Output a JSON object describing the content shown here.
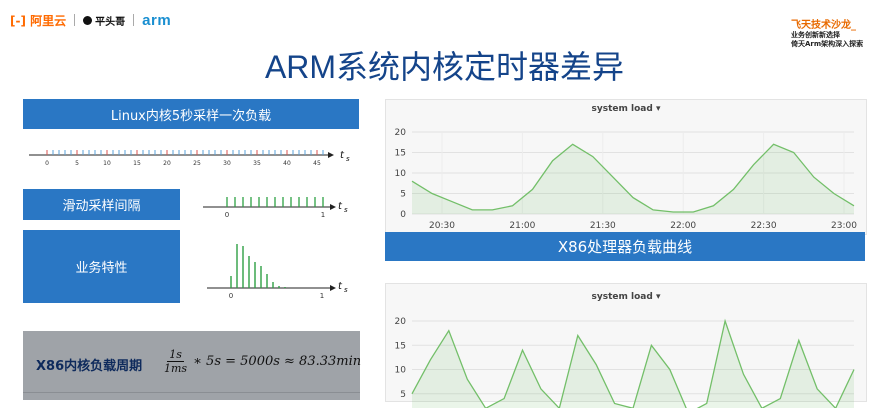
{
  "header": {
    "logo_aliyun": "阿里云",
    "logo_pingtouge": "平头哥",
    "logo_arm": "arm",
    "corner_title": "飞天技术沙龙_",
    "corner_line2": "业务创新新选择",
    "corner_line3": "倚天Arm架构深入探索"
  },
  "slide": {
    "title": "ARM系统内核定时器差异"
  },
  "left": {
    "box1_label": "Linux内核5秒采样一次负载",
    "box1_ticks": [
      "0",
      "5",
      "10",
      "15",
      "20",
      "25",
      "30",
      "35",
      "40",
      "45"
    ],
    "box1_axis": "t",
    "box1_axis_sub": "s",
    "box2_label": "滑动采样间隔",
    "box2_ticks": [
      "0",
      "1"
    ],
    "box3_label": "业务特性",
    "box3_ticks": [
      "0",
      "1"
    ],
    "formula_label": "X86内核负载周期",
    "formula_num": "1s",
    "formula_den": "1ms",
    "formula_rest": "∗ 5s = 5000s ≈ 83.33min"
  },
  "charts": {
    "top_title": "system load ▾",
    "top_caption": "X86处理器负载曲线",
    "bottom_title": "system load ▾"
  },
  "chart_data": [
    {
      "type": "line",
      "title": "system load",
      "x": [
        "20:30",
        "21:00",
        "21:30",
        "22:00",
        "22:30",
        "23:00"
      ],
      "y_ticks": [
        0,
        5,
        10,
        15,
        20
      ],
      "ylim": [
        0,
        20
      ],
      "series": [
        {
          "values": [
            8,
            5,
            3,
            1,
            1,
            2,
            6,
            13,
            17,
            14,
            9,
            4,
            1,
            0.5,
            0.5,
            2,
            6,
            12,
            17,
            15,
            9,
            5,
            2
          ]
        }
      ],
      "color": "#73bf69"
    },
    {
      "type": "line",
      "title": "system load",
      "y_ticks": [
        0,
        5,
        10,
        15,
        20
      ],
      "ylim": [
        0,
        20
      ],
      "series": [
        {
          "values": [
            5,
            12,
            18,
            8,
            2,
            4,
            14,
            6,
            2,
            17,
            11,
            3,
            2,
            15,
            10,
            1,
            3,
            20,
            9,
            2,
            4,
            16,
            6,
            2,
            10
          ]
        }
      ],
      "color": "#73bf69"
    }
  ]
}
